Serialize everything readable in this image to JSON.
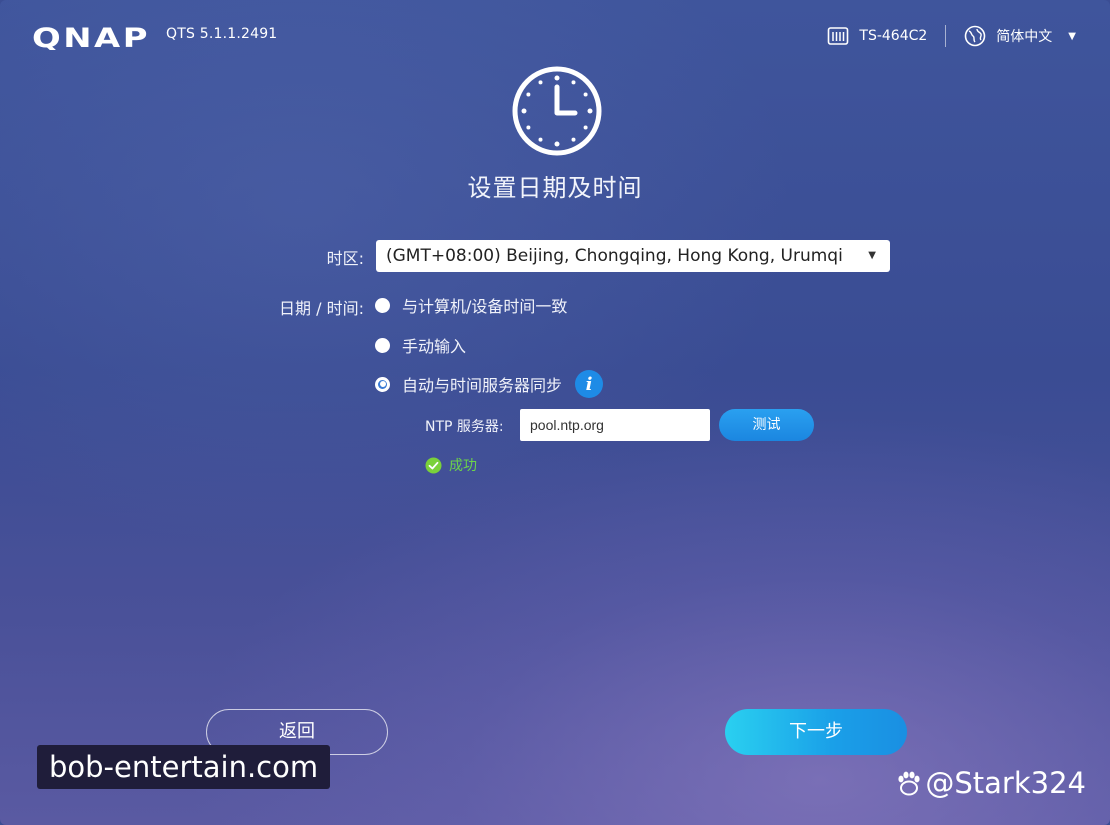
{
  "header": {
    "brand": "QNAP",
    "version": "QTS 5.1.1.2491",
    "device_name": "TS-464C2",
    "language": "简体中文"
  },
  "page": {
    "title": "设置日期及时间"
  },
  "form": {
    "timezone_label": "时区:",
    "timezone_value": "(GMT+08:00) Beijing, Chongqing, Hong Kong, Urumqi",
    "datetime_label": "日期 / 时间:",
    "options": [
      {
        "label": "与计算机/设备时间一致",
        "selected": false
      },
      {
        "label": "手动输入",
        "selected": false
      },
      {
        "label": "自动与时间服务器同步",
        "selected": true
      }
    ],
    "ntp_label": "NTP 服务器:",
    "ntp_value": "pool.ntp.org",
    "test_label": "测试",
    "status_text": "成功"
  },
  "footer": {
    "back_label": "返回",
    "next_label": "下一步"
  },
  "watermarks": {
    "left": "bob-entertain.com",
    "right": "@Stark324"
  },
  "colors": {
    "accent": "#1e8be6",
    "success": "#6cd34a",
    "next_button": "#1a9fe8"
  },
  "icons": {
    "device": "nas-device-icon",
    "language": "globe-icon",
    "clock": "clock-icon",
    "info": "info-icon",
    "status": "check-circle-icon"
  }
}
